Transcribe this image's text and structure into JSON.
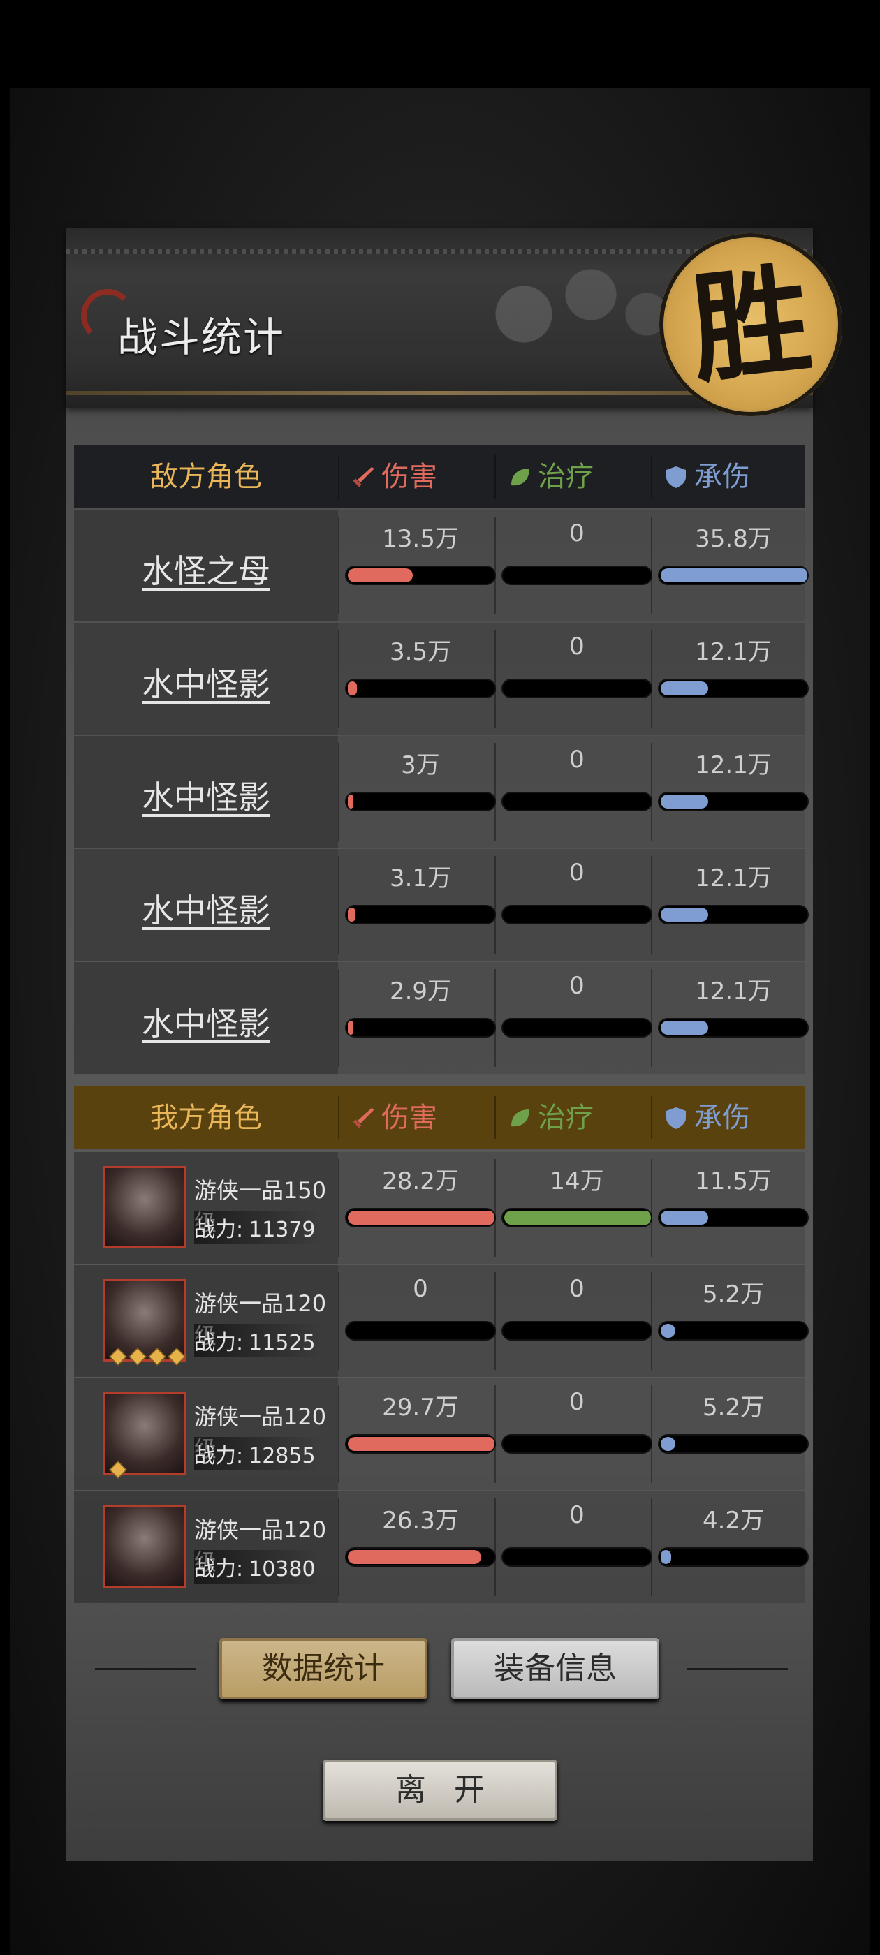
{
  "title": "战斗统计",
  "result_seal": "胜",
  "enemy_header": {
    "name": "敌方角色",
    "damage": "伤害",
    "heal": "治疗",
    "taken": "承伤"
  },
  "ally_header": {
    "name": "我方角色",
    "damage": "伤害",
    "heal": "治疗",
    "taken": "承伤"
  },
  "colors": {
    "damage": "#e06a5e",
    "heal": "#6fa04a",
    "taken": "#7f9dd0",
    "enemy_header_bg": "#1d1f22",
    "ally_header_bg": "#5a420f",
    "gold": "#e9b75a"
  },
  "enemies": [
    {
      "name": "水怪之母",
      "damage": "13.5万",
      "damage_frac": 0.44,
      "heal": "0",
      "heal_frac": 0,
      "taken": "35.8万",
      "taken_frac": 1.0
    },
    {
      "name": "水中怪影",
      "damage": "3.5万",
      "damage_frac": 0.06,
      "heal": "0",
      "heal_frac": 0,
      "taken": "12.1万",
      "taken_frac": 0.32
    },
    {
      "name": "水中怪影",
      "damage": "3万",
      "damage_frac": 0.04,
      "heal": "0",
      "heal_frac": 0,
      "taken": "12.1万",
      "taken_frac": 0.32
    },
    {
      "name": "水中怪影",
      "damage": "3.1万",
      "damage_frac": 0.05,
      "heal": "0",
      "heal_frac": 0,
      "taken": "12.1万",
      "taken_frac": 0.32
    },
    {
      "name": "水中怪影",
      "damage": "2.9万",
      "damage_frac": 0.04,
      "heal": "0",
      "heal_frac": 0,
      "taken": "12.1万",
      "taken_frac": 0.32
    }
  ],
  "allies": [
    {
      "rank": "游侠一品150级",
      "power_label": "战力:",
      "power": "11379",
      "stars": 0,
      "damage": "28.2万",
      "damage_frac": 1.0,
      "heal": "14万",
      "heal_frac": 1.0,
      "taken": "11.5万",
      "taken_frac": 0.32
    },
    {
      "rank": "游侠一品120级",
      "power_label": "战力:",
      "power": "11525",
      "stars": 4,
      "damage": "0",
      "damage_frac": 0,
      "heal": "0",
      "heal_frac": 0,
      "taken": "5.2万",
      "taken_frac": 0.1
    },
    {
      "rank": "游侠一品120级",
      "power_label": "战力:",
      "power": "12855",
      "stars": 1,
      "damage": "29.7万",
      "damage_frac": 1.0,
      "heal": "0",
      "heal_frac": 0,
      "taken": "5.2万",
      "taken_frac": 0.1
    },
    {
      "rank": "游侠一品120级",
      "power_label": "战力:",
      "power": "10380",
      "stars": 0,
      "damage": "26.3万",
      "damage_frac": 0.9,
      "heal": "0",
      "heal_frac": 0,
      "taken": "4.2万",
      "taken_frac": 0.07
    }
  ],
  "buttons": {
    "stats": "数据统计",
    "equip": "装备信息",
    "leave": "离开"
  }
}
